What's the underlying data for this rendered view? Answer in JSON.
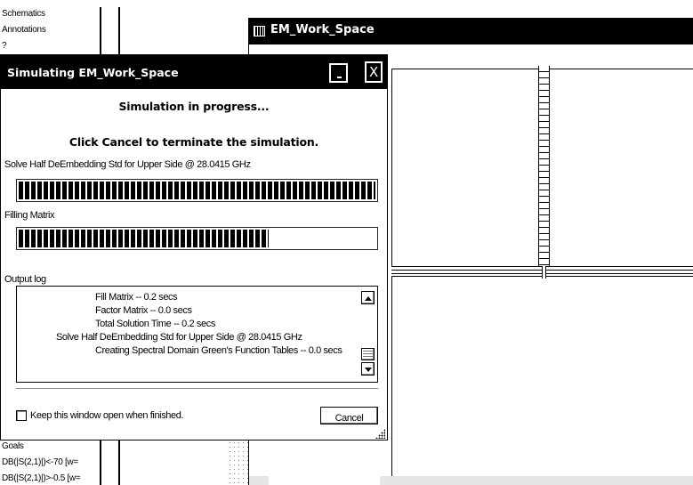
{
  "background": {
    "tree_items": [
      "Schematics",
      "Annotations",
      "?"
    ],
    "goals_label": "Goals",
    "goal_lines": [
      "DB(|S(2,1)|)<-70 [w=",
      "DB(|S(2,1)|)>-0.5 [w="
    ]
  },
  "workspace": {
    "title": "EM_Work_Space"
  },
  "dialog": {
    "title": "Simulating EM_Work_Space",
    "minimize_label": "_",
    "close_label": "X",
    "status_heading": "Simulation in progress...",
    "cancel_hint": "Click Cancel to terminate the simulation.",
    "task_label": "Solve Half DeEmbedding Std for Upper Side @ 28.0415 GHz",
    "task_progress_percent": 100,
    "subtask_label": "Filling Matrix",
    "subtask_progress_percent": 70,
    "output_log_label": "Output log",
    "log_lines": [
      "Fill Matrix -- 0.2 secs",
      "Factor Matrix -- 0.0 secs",
      "Total Solution Time -- 0.2 secs",
      "Solve Half DeEmbedding Std for Upper Side @ 28.0415 GHz",
      "Creating Spectral Domain Green's Function Tables -- 0.0 secs"
    ],
    "keep_open_label": "Keep this window open when finished.",
    "keep_open_checked": false,
    "cancel_button": "Cancel"
  }
}
